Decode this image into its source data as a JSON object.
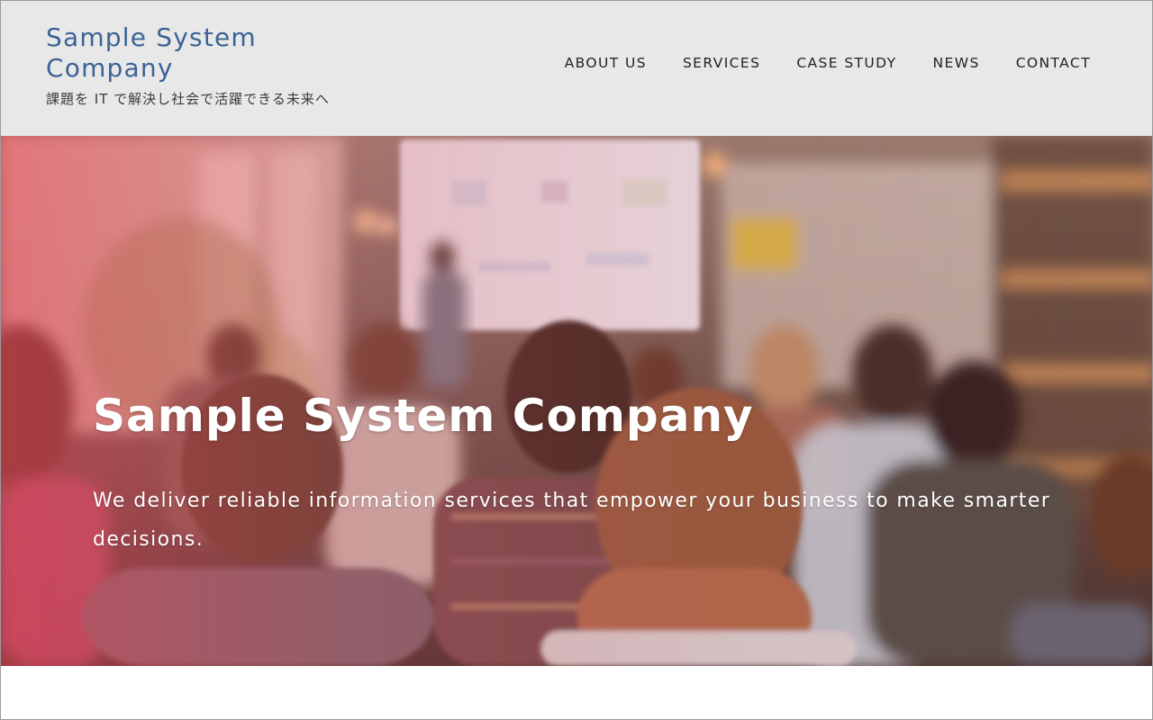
{
  "brand": {
    "title": "Sample System Company",
    "tagline": "課題を IT で解決し社会で活躍できる未来へ"
  },
  "nav": {
    "items": [
      {
        "label": "ABOUT US"
      },
      {
        "label": "SERVICES"
      },
      {
        "label": "CASE STUDY"
      },
      {
        "label": "NEWS"
      },
      {
        "label": "CONTACT"
      }
    ]
  },
  "hero": {
    "headline": "Sample System Company",
    "description": "We deliver reliable information services that empower your business to make smarter decisions."
  },
  "colors": {
    "brand": "#3b6394",
    "header_bg": "#e8e8e9",
    "hero_tint": "#e8465a",
    "text_light": "#ffffff"
  }
}
